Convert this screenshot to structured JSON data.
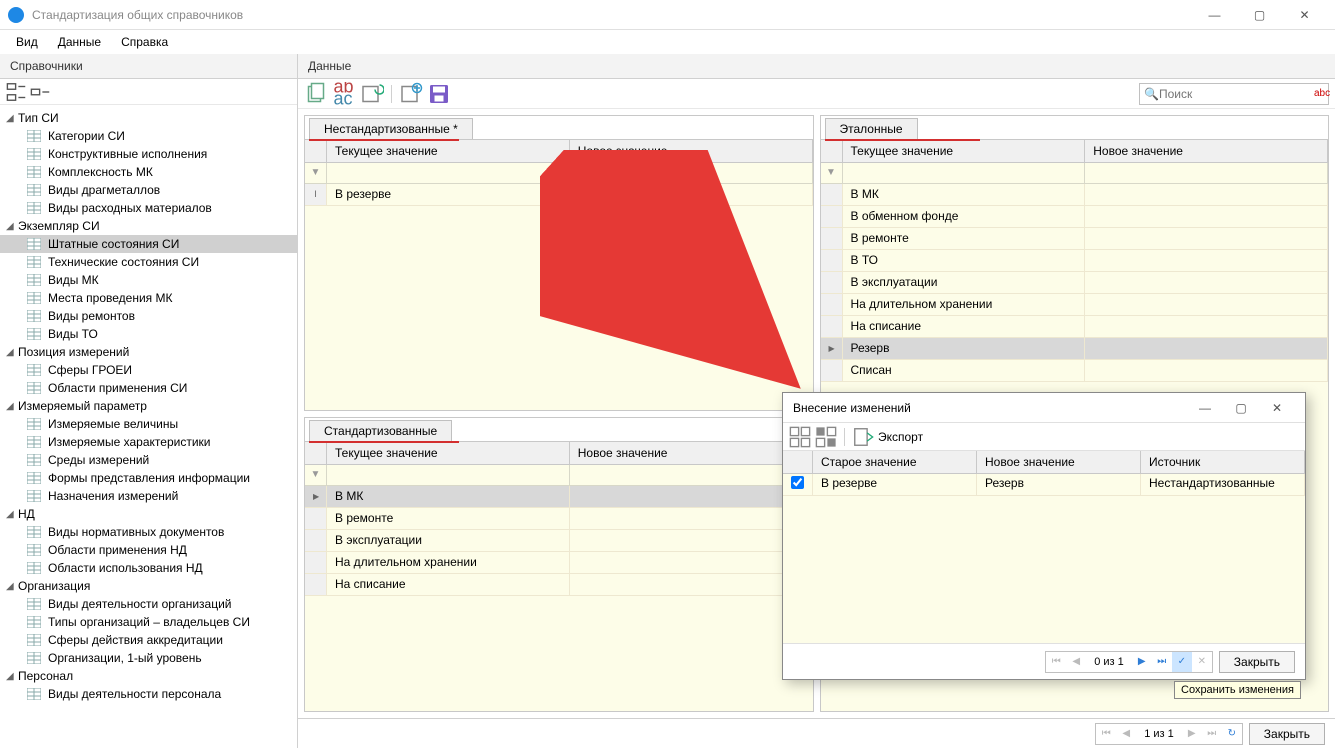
{
  "window": {
    "title": "Стандартизация общих справочников"
  },
  "menubar": {
    "items": [
      "Вид",
      "Данные",
      "Справка"
    ]
  },
  "left_panel": {
    "title": "Справочники"
  },
  "right_panel": {
    "title": "Данные"
  },
  "search": {
    "placeholder": "Поиск",
    "abc": "abc"
  },
  "tree": {
    "groups": [
      {
        "label": "Тип СИ",
        "items": [
          "Категории СИ",
          "Конструктивные исполнения",
          "Комплексность МК",
          "Виды драгметаллов",
          "Виды расходных материалов"
        ]
      },
      {
        "label": "Экземпляр СИ",
        "items": [
          "Штатные состояния СИ",
          "Технические состояния СИ",
          "Виды МК",
          "Места проведения МК",
          "Виды ремонтов",
          "Виды ТО"
        ],
        "selected": 0
      },
      {
        "label": "Позиция измерений",
        "items": [
          "Сферы ГРОЕИ",
          "Области применения СИ"
        ]
      },
      {
        "label": "Измеряемый параметр",
        "items": [
          "Измеряемые величины",
          "Измеряемые характеристики",
          "Среды измерений",
          "Формы представления информации",
          "Назначения измерений"
        ]
      },
      {
        "label": "НД",
        "items": [
          "Виды нормативных документов",
          "Области применения НД",
          "Области использования НД"
        ]
      },
      {
        "label": "Организация",
        "items": [
          "Виды деятельности организаций",
          "Типы организаций – владельцев СИ",
          "Сферы действия аккредитации",
          "Организации, 1-ый уровень"
        ]
      },
      {
        "label": "Персонал",
        "items": [
          "Виды деятельности персонала"
        ]
      }
    ]
  },
  "grid_nonstd": {
    "tab": "Нестандартизованные *",
    "headers": {
      "c1": "Текущее значение",
      "c2": "Новое значение"
    },
    "rows": [
      {
        "c1": "В резерве",
        "c2": "Резерв",
        "editing": true
      }
    ]
  },
  "grid_ref": {
    "tab": "Эталонные",
    "headers": {
      "c1": "Текущее значение",
      "c2": "Новое значение"
    },
    "rows": [
      {
        "c1": "В МК"
      },
      {
        "c1": "В обменном фонде"
      },
      {
        "c1": "В ремонте"
      },
      {
        "c1": "В ТО"
      },
      {
        "c1": "В эксплуатации"
      },
      {
        "c1": "На длительном хранении"
      },
      {
        "c1": "На списание"
      },
      {
        "c1": "Резерв",
        "selected": true
      },
      {
        "c1": "Списан"
      }
    ]
  },
  "grid_std": {
    "tab": "Стандартизованные",
    "headers": {
      "c1": "Текущее значение",
      "c2": "Новое значение"
    },
    "rows": [
      {
        "c1": "В МК",
        "selected": true
      },
      {
        "c1": "В ремонте"
      },
      {
        "c1": "В эксплуатации"
      },
      {
        "c1": "На длительном хранении"
      },
      {
        "c1": "На списание"
      }
    ]
  },
  "dialog": {
    "title": "Внесение изменений",
    "export": "Экспорт",
    "headers": {
      "c1": "Старое значение",
      "c2": "Новое значение",
      "c3": "Источник"
    },
    "rows": [
      {
        "checked": true,
        "c1": "В резерве",
        "c2": "Резерв",
        "c3": "Нестандартизованные"
      }
    ],
    "nav": "0 из 1",
    "close": "Закрыть",
    "tooltip": "Сохранить изменения"
  },
  "footer": {
    "nav": "1 из 1",
    "close": "Закрыть"
  }
}
